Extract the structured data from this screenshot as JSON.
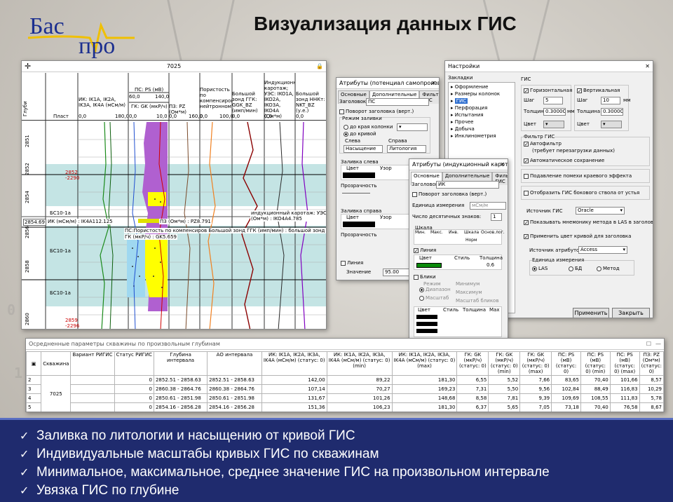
{
  "logo": {
    "left": "Бас",
    "right": "про"
  },
  "slide_title": "Визуализация данных ГИС",
  "log_window": {
    "title": "7025",
    "col_depth": "Глубина",
    "col_layer": "Пласт",
    "curves": [
      {
        "label": "ИК: IK1A, IK2A, IK3A, IK4A (мСм/м)",
        "min": "0,0",
        "max": "180,0"
      },
      {
        "label": "ПС: PS (мВ)",
        "min": "60,0",
        "max": "140,0"
      },
      {
        "label": "ГК: GK (мкР/ч)",
        "min": "0,0",
        "max": "10,0"
      },
      {
        "label": "ПЗ: PZ (Ом*м)",
        "min": "0,0",
        "max": "160,0"
      },
      {
        "label": "Пористость по компенсиров нейтронному",
        "min": "0,0",
        "max": "100,0"
      },
      {
        "label": "Большой зонд ГГК: GGK_BZ (имп/мин)",
        "min": "0,0",
        "max": ""
      },
      {
        "label": "Индукционный каротаж; УЭС: IKO1A, IKO2A, IKO3A, IKO4A (Ом*м)",
        "min": "0,0",
        "max": ""
      },
      {
        "label": "Большой зонд ННКт: NKT_BZ (у.е.)",
        "min": "0,0",
        "max": ""
      }
    ],
    "depths": [
      "2851",
      "2852",
      "2853",
      "2854",
      "2855",
      "2856",
      "2857",
      "2858",
      "2859",
      "2860"
    ],
    "depth_marker": "2854.69",
    "marks": [
      {
        "top": "2852",
        "bottom": "-2290"
      },
      {
        "top": "2859",
        "bottom": "-2296"
      }
    ],
    "layers": [
      "БС10-1а",
      "БС10-1а",
      "БС10-1а"
    ],
    "tip1": "ИК (мСм/м) : IK4A112.125",
    "tip2": "ПЗ (Ом*м) : PZ8.791",
    "tip3": "индукционный каротаж: УЭС (Ом*м) : IKO4A4.785",
    "tip4": "ПС:Пористость по компенсиров Большой зонд ГГК (имп/мин) : большой зонд ННКт (у.е.) :",
    "tip5": "ГК (мкР/ч) : GK5.659"
  },
  "attr_sp": {
    "title": "Атрибуты (потенциал самопроизволь...",
    "tabs": [
      "Основные",
      "Дополнительные",
      "Фильтр ГИС"
    ],
    "caption_label": "Заголовок:",
    "caption_value": "ПС",
    "rotate": "Поворот заголовка (верт.)",
    "fill_mode": "Режим заливки",
    "opt_edge": "до края колонки",
    "opt_curve": "до кривой",
    "left_lbl": "Слева",
    "right_lbl": "Справа",
    "left_val": "Насыщение",
    "right_val": "Литология",
    "fill_left": "Заливка слева",
    "fill_right": "Заливка справа",
    "col_color": "Цвет",
    "col_pattern": "Узор",
    "transparency": "Прозрачность",
    "line": "Линия",
    "value_lbl": "Значение",
    "value": "95.00"
  },
  "attr_ik": {
    "title": "Атрибуты (индукционный каротаж: про...",
    "tabs": [
      "Основные",
      "Дополнительные",
      "Фильтр ГИС"
    ],
    "caption_label": "Заголовок:",
    "caption_value": "ИК",
    "rotate": "Поворот заголовка (верт.)",
    "unit_lbl": "Единица измерения",
    "unit_val": "мСм/м",
    "decimals_lbl": "Число десятичных знаков:",
    "decimals": "1",
    "scale": "Шкала",
    "scale_cols": [
      "Мин.",
      "Макс.",
      "Инв.",
      "Шкала",
      "Основ.лог."
    ],
    "scale_kind": "Норм",
    "line": "Линия",
    "line_cols": [
      "Цвет",
      "Стиль",
      "Толщина"
    ],
    "line_w": "0.6",
    "glare": "Блики",
    "mode": "Режим",
    "range": "Диапазон",
    "scaled": "Масштаб",
    "minimum": "Минимум",
    "maximum": "Максимум",
    "glare_scale": "Масштаб бликов",
    "glare_cols": [
      "Цвет",
      "Стиль",
      "Толщина",
      "Max"
    ]
  },
  "settings": {
    "title": "Настройки",
    "bookmarks": "Закладки",
    "tree": [
      "Оформление",
      "Размеры колонок",
      "ГИС",
      "Перфорация",
      "Испытания",
      "Прочее",
      "Добыча",
      "Инклинометрия"
    ],
    "gis": "ГИС",
    "horizontal": "Горизонтальная",
    "vertical": "Вертикальная",
    "step": "Шаг",
    "h_step": "5",
    "v_step": "10",
    "unit_mm": "мм",
    "thickness": "Толщина",
    "h_thick": "0.3000С",
    "v_thick": "0.3000С",
    "color": "Цвет",
    "filter_group": "Фильтр ГИС",
    "autofilter": "Автофильтр",
    "autofilter_note": "(требует перезагрузки данных)",
    "autosave": "Автоматическое сохранение",
    "suppress": "Подавление помехи краевого эффекта",
    "sidetrack": "Отобразить ГИС бокового ствола от устья",
    "source_lbl": "Источник ГИС",
    "source_val": "Oracle",
    "show_mnemonic": "Показывать мнемонику метода в LAS в заголовке",
    "apply_color": "Применить цвет кривой для заголовка",
    "attr_source_lbl": "Источник атрибутов",
    "attr_source_val": "Access",
    "units_group": "Единица измерения",
    "u_las": "LAS",
    "u_bd": "БД",
    "u_method": "Метод",
    "apply_btn": "Применить",
    "close_btn": "Закрыть"
  },
  "avg_table": {
    "title": "Осредненные параметры скважины по произвольным глубинам",
    "headers": [
      "Скважина",
      "Вариант РИГИС",
      "Статус РИГИС",
      "Глубина интервала",
      "АО интервала",
      "ИК: IK1A, IK2A, IK3A, IK4A (мСм/м) (статус: 0)",
      "ИК: IK1A, IK2A, IK3A, IK4A (мСм/м) (статус: 0) (min)",
      "ИК: IK1A, IK2A, IK3A, IK4A (мСм/м) (статус: 0) (max)",
      "ГК: GK (мкР/ч) (статус: 0)",
      "ГК: GK (мкР/ч) (статус: 0) (min)",
      "ГК: GK (мкР/ч) (статус: 0) (max)",
      "ПС: PS (мВ) (статус: 0)",
      "ПС: PS (мВ) (статус: 0) (min)",
      "ПС: PS (мВ) (статус: 0) (max)",
      "ПЗ: PZ (Ом*м) (статус: 0)"
    ],
    "well": "7025",
    "rows": [
      {
        "n": "2",
        "status": "0",
        "depth": "2852.51 - 2858.63",
        "ao": "2852.51 - 2858.63",
        "v": [
          "142,00",
          "89,22",
          "181,30",
          "6,55",
          "5,52",
          "7,66",
          "83,65",
          "70,40",
          "101,66",
          "8,57"
        ]
      },
      {
        "n": "3",
        "status": "0",
        "depth": "2860.38 - 2864.76",
        "ao": "2860.38 - 2864.76",
        "v": [
          "107,14",
          "70,27",
          "169,23",
          "7,31",
          "5,50",
          "9,56",
          "102,84",
          "88,49",
          "116,83",
          "10,29"
        ]
      },
      {
        "n": "4",
        "status": "0",
        "depth": "2850.61 - 2851.98",
        "ao": "2850.61 - 2851.98",
        "v": [
          "131,67",
          "101,26",
          "148,68",
          "8,58",
          "7,81",
          "9,39",
          "109,69",
          "108,55",
          "111,83",
          "5,78"
        ]
      },
      {
        "n": "5",
        "status": "0",
        "depth": "2854.16 - 2856.28",
        "ao": "2854.16 - 2856.28",
        "v": [
          "151,36",
          "106,23",
          "181,30",
          "6,37",
          "5,65",
          "7,05",
          "73,18",
          "70,40",
          "76,58",
          "8,67"
        ]
      }
    ]
  },
  "bullets": [
    "Заливка по литологии и насыщению от кривой ГИС",
    "Индивидуальные масштабы кривых ГИС по скважинам",
    "Минимальное, максимальное, среднее значение ГИС на произвольном интервале",
    "Увязка ГИС по глубине"
  ],
  "colors": {
    "bar_bg": "#1f2b6e",
    "logo_blue": "#1c2f8f",
    "logo_yellow": "#f0c000",
    "layer_fill": "#c4e4e4",
    "lith_fill": "#b060d0",
    "sand_fill": "#ffff00"
  }
}
